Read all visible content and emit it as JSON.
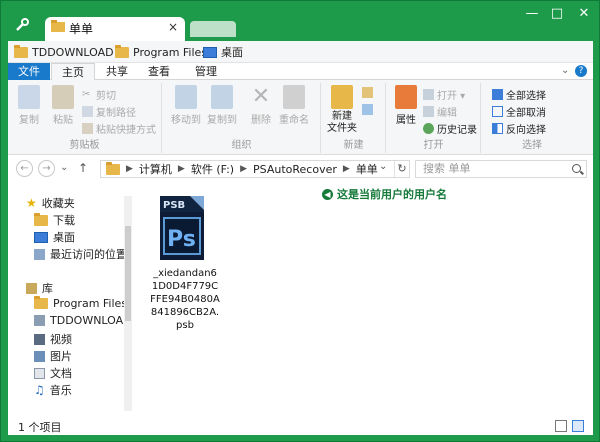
{
  "window": {
    "tab_title": "单单",
    "tab_close": "×",
    "minimize": "—",
    "maximize": "□",
    "close": "✕",
    "accent": "#1d9b4a"
  },
  "favorites_bar": [
    {
      "label": "TDDOWNLOAD",
      "icon": "folder-icon"
    },
    {
      "label": "Program Files",
      "icon": "folder-icon"
    },
    {
      "label": "桌面",
      "icon": "desktop-icon"
    }
  ],
  "menu": {
    "file": "文件",
    "tabs": [
      "主页",
      "共享",
      "查看",
      "管理"
    ],
    "expand": "⌄",
    "help": "?"
  },
  "ribbon": {
    "clipboard": {
      "group": "剪贴板",
      "copy": "复制",
      "paste": "粘贴",
      "cut": "剪切",
      "copy_path": "复制路径",
      "paste_shortcut": "粘贴快捷方式"
    },
    "organize": {
      "group": "组织",
      "move_to": "移动到",
      "copy_to": "复制到",
      "delete": "删除",
      "rename": "重命名"
    },
    "new": {
      "group": "新建",
      "new_folder": "新建\n文件夹"
    },
    "open": {
      "group": "打开",
      "properties": "属性",
      "open": "打开 ▾",
      "edit": "编辑",
      "history": "历史记录"
    },
    "select": {
      "group": "选择",
      "select_all": "全部选择",
      "select_none": "全部取消",
      "invert": "反向选择"
    }
  },
  "address": {
    "back": "←",
    "forward": "→",
    "recent": "⌄",
    "up": "↑",
    "crumbs": [
      "计算机",
      "软件 (F:)",
      "PSAutoRecover",
      "单单"
    ],
    "dropdown": "⌄",
    "refresh": "↻",
    "search_placeholder": "搜索 单单"
  },
  "nav_pane": {
    "favorites": "收藏夹",
    "fav_items": [
      "下载",
      "桌面",
      "最近访问的位置"
    ],
    "library": "库",
    "lib_items": [
      "Program Files",
      "TDDOWNLOAD",
      "视频",
      "图片",
      "文档",
      "音乐"
    ]
  },
  "files": [
    {
      "name": "_xiedandan61D0D4F779CFFE94B0480A841896CB2A.psb",
      "icon_text_top": "PSB",
      "icon_text_main": "Ps"
    }
  ],
  "annotation": "这是当前用户的用户名",
  "status": {
    "count": "1 个项目"
  }
}
